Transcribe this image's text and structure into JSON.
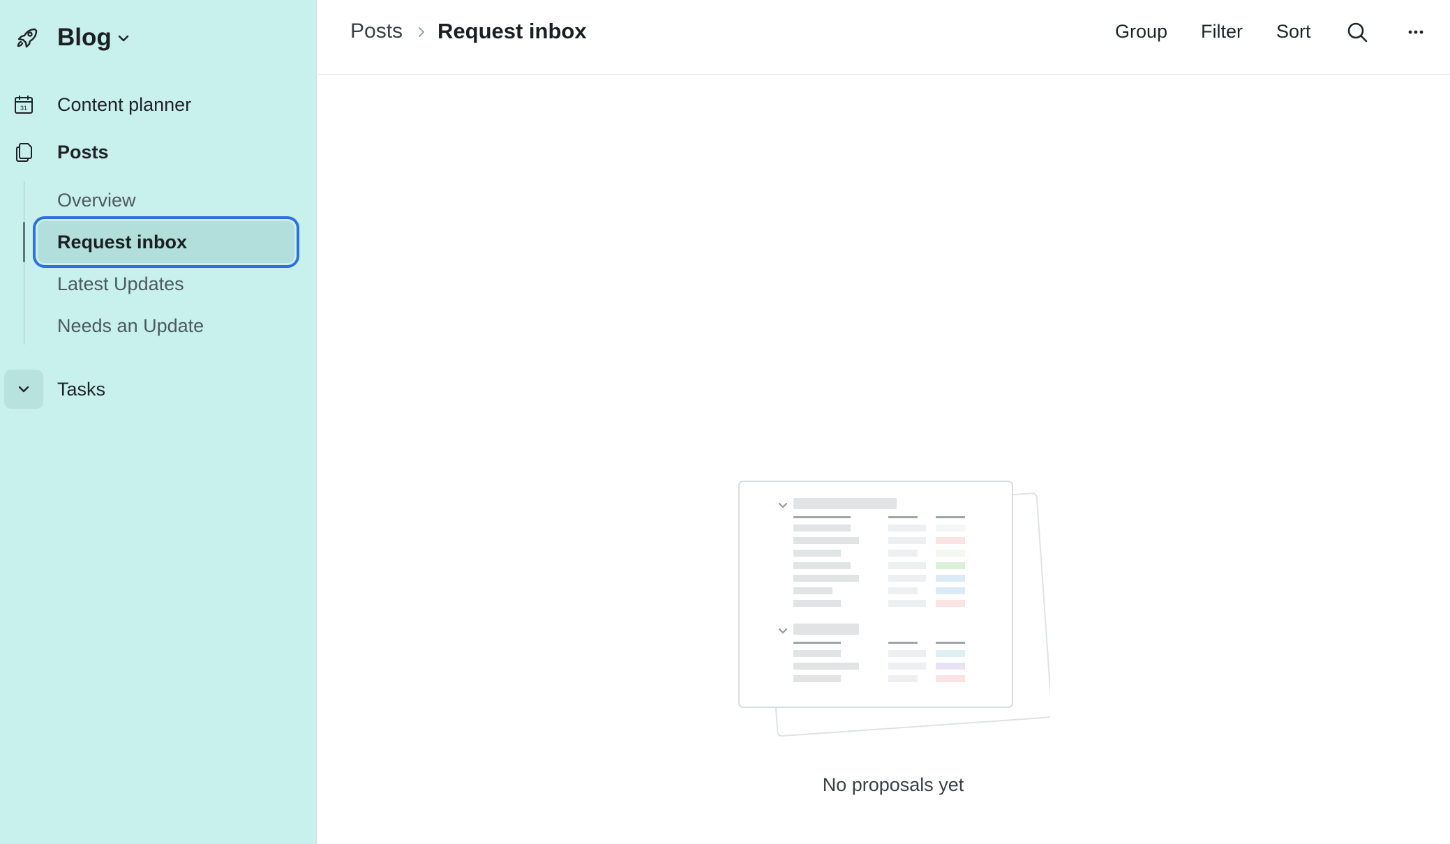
{
  "sidebar": {
    "workspace_name": "Blog",
    "workspace_icon": "rocket-icon",
    "items": [
      {
        "label": "Content planner",
        "icon": "calendar-icon"
      },
      {
        "label": "Posts",
        "icon": "documents-icon"
      }
    ],
    "sub_items": [
      {
        "label": "Overview"
      },
      {
        "label": "Request inbox",
        "active": true
      },
      {
        "label": "Latest Updates"
      },
      {
        "label": "Needs an Update"
      }
    ],
    "tasks_label": "Tasks",
    "accent": "#2f6fe0",
    "background": "#c8f0ec"
  },
  "header": {
    "breadcrumb_root": "Posts",
    "breadcrumb_current": "Request inbox",
    "group_label": "Group",
    "filter_label": "Filter",
    "sort_label": "Sort",
    "search_icon": "search-icon",
    "more_icon": "more-horizontal-icon"
  },
  "main": {
    "empty_text": "No proposals yet"
  }
}
